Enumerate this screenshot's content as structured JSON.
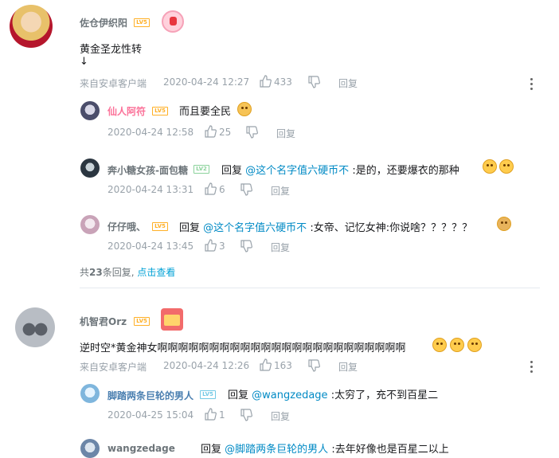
{
  "comments": [
    {
      "username": "佐仓伊织阳",
      "level": "LV5",
      "line1": "黄金圣龙性转",
      "line2": "↓",
      "source": "来自安卓客户端",
      "time": "2020-04-24 12:27",
      "likes": "433",
      "reply_label": "回复",
      "replies": [
        {
          "username": "仙人阿符",
          "level": "LV5",
          "prefix": "",
          "mention": "",
          "text": "而且要全民",
          "time": "2020-04-24 12:58",
          "likes": "25",
          "reply_label": "回复"
        },
        {
          "username": "奔小糖女孩-面包糖",
          "level": "LV2",
          "prefix": "回复",
          "mention": "@这个名字值六硬币不",
          "text": ":是的，还要爆衣的那种",
          "time": "2020-04-24 13:31",
          "likes": "6",
          "reply_label": "回复"
        },
        {
          "username": "仔仔哦、",
          "level": "LV5",
          "prefix": "回复",
          "mention": "@这个名字值六硬币不",
          "text": ":女帝、记忆女神:你说啥？？？？？",
          "time": "2020-04-24 13:45",
          "likes": "3",
          "reply_label": "回复"
        }
      ],
      "summary_prefix": "共",
      "summary_count": "23",
      "summary_suffix": "条回复,",
      "view_more": "点击查看"
    },
    {
      "username": "机智君Orz",
      "level": "LV5",
      "line1": "逆时空*黄金神女啊啊啊啊啊啊啊啊啊啊啊啊啊啊啊啊啊啊啊啊啊啊啊啊",
      "source": "来自安卓客户端",
      "time": "2020-04-24 12:26",
      "likes": "163",
      "reply_label": "回复",
      "replies": [
        {
          "username": "脚踏两条巨轮的男人",
          "level": "LV5",
          "prefix": "回复",
          "mention": "@wangzedage",
          "text": ":太穷了，充不到百星二",
          "time": "2020-04-25 15:04",
          "likes": "1",
          "reply_label": "回复"
        },
        {
          "username": "wangzedage",
          "level": "LV5",
          "prefix": "回复",
          "mention": "@脚踏两条巨轮的男人",
          "text": ":去年好像也是百星二以上",
          "time": "",
          "likes": "",
          "reply_label": ""
        }
      ]
    }
  ],
  "icons": {
    "like": "thumb-up-icon",
    "dislike": "thumb-down-icon",
    "more": "more-vertical-icon"
  },
  "colors": {
    "link": "#008ac5",
    "meta": "#99a2aa",
    "level_orange": "#ffb027",
    "pink_name": "#fb7299",
    "view_more": "#00a1d6"
  }
}
